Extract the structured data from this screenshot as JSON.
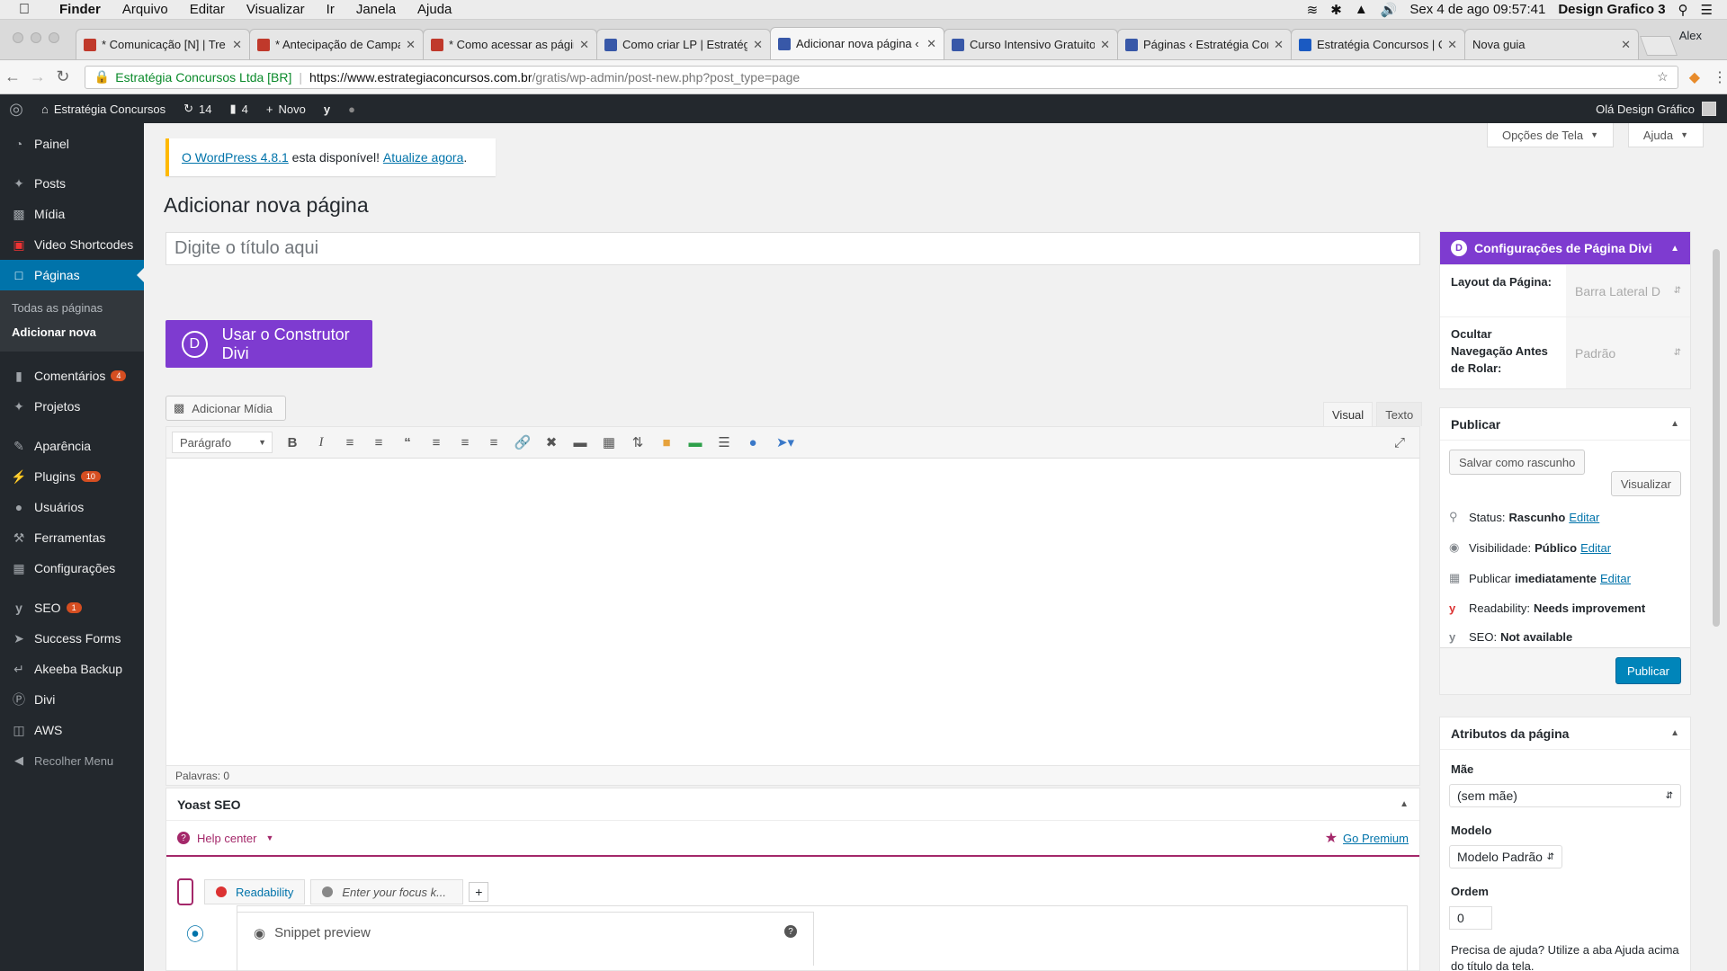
{
  "macos": {
    "finder": "Finder",
    "menus": [
      "Arquivo",
      "Editar",
      "Visualizar",
      "Ir",
      "Janela",
      "Ajuda"
    ],
    "clock": "Sex 4 de ago  09:57:41",
    "user": "Design Grafico 3"
  },
  "browser": {
    "tabs": [
      {
        "title": "* Comunicação [N] | Tre",
        "color": "#c0392b"
      },
      {
        "title": "* Antecipação de Campa",
        "color": "#c0392b"
      },
      {
        "title": "* Como acessar as págin",
        "color": "#c0392b"
      },
      {
        "title": "Como criar LP | Estratég",
        "color": "#3858a8"
      },
      {
        "title": "Adicionar nova página ‹",
        "color": "#3858a8"
      },
      {
        "title": "Curso Intensivo Gratuito",
        "color": "#3858a8"
      },
      {
        "title": "Páginas ‹ Estratégia Con",
        "color": "#3858a8"
      },
      {
        "title": "Estratégia Concursos | C",
        "color": "#1a5ac2"
      },
      {
        "title": "Nova guia",
        "color": ""
      }
    ],
    "profile": "Alex",
    "secure_label": "Estratégia Concursos Ltda [BR]",
    "url_host": "https://www.estrategiaconcursos.com.br",
    "url_path": "/gratis/wp-admin/post-new.php?post_type=page"
  },
  "adminbar": {
    "site": "Estratégia Concursos",
    "updates": "14",
    "comments": "4",
    "new": "Novo",
    "greeting": "Olá Design Gráfico"
  },
  "sidebar": {
    "items": [
      {
        "label": "Painel",
        "icon": "gauge-icon"
      },
      {
        "label": "Posts",
        "icon": "pin-icon"
      },
      {
        "label": "Mídia",
        "icon": "media-icon"
      },
      {
        "label": "Video Shortcodes",
        "icon": "video-icon"
      },
      {
        "label": "Páginas",
        "icon": "page-icon"
      },
      {
        "label": "Comentários",
        "icon": "comment-icon",
        "badge": "4"
      },
      {
        "label": "Projetos",
        "icon": "pin-icon"
      },
      {
        "label": "Aparência",
        "icon": "brush-icon"
      },
      {
        "label": "Plugins",
        "icon": "plug-icon",
        "badge": "10"
      },
      {
        "label": "Usuários",
        "icon": "user-icon"
      },
      {
        "label": "Ferramentas",
        "icon": "wrench-icon"
      },
      {
        "label": "Configurações",
        "icon": "settings-icon"
      },
      {
        "label": "SEO",
        "icon": "yoast-icon",
        "badge": "1"
      },
      {
        "label": "Success Forms",
        "icon": "rocket-icon"
      },
      {
        "label": "Akeeba Backup",
        "icon": "backup-icon"
      },
      {
        "label": "Divi",
        "icon": "divi-icon"
      },
      {
        "label": "AWS",
        "icon": "aws-icon"
      }
    ],
    "sub": [
      "Todas as páginas",
      "Adicionar nova"
    ],
    "collapse": "Recolher Menu"
  },
  "main": {
    "screen_options": "Opções de Tela",
    "help": "Ajuda",
    "notice_link1": "O WordPress 4.8.1",
    "notice_text": " esta disponível! ",
    "notice_link2": "Atualize agora",
    "notice_end": ".",
    "page_title": "Adicionar nova página",
    "title_placeholder": "Digite o título aqui",
    "divi_button": "Usar o Construtor Divi",
    "add_media": "Adicionar Mídia",
    "tab_visual": "Visual",
    "tab_text": "Texto",
    "format": "Parágrafo",
    "word_count": "Palavras: 0"
  },
  "yoast": {
    "title": "Yoast SEO",
    "help_center": "Help center",
    "go_premium": "Go Premium",
    "readability_tab": "Readability",
    "focus_tab": "Enter your focus k...",
    "snippet": "Snippet preview"
  },
  "divi_settings": {
    "title": "Configurações de Página Divi",
    "layout_label": "Layout da Página:",
    "layout_value": "Barra Lateral D",
    "hide_nav_label": "Ocultar Navegação Antes de Rolar:",
    "hide_nav_value": "Padrão"
  },
  "publish": {
    "title": "Publicar",
    "save_draft": "Salvar como rascunho",
    "preview": "Visualizar",
    "status_label": "Status:",
    "status_value": "Rascunho",
    "visibility_label": "Visibilidade:",
    "visibility_value": "Público",
    "publish_label": "Publicar",
    "publish_value": "imediatamente",
    "edit": "Editar",
    "readability_label": "Readability:",
    "readability_value": "Needs improvement",
    "seo_label": "SEO:",
    "seo_value": "Not available",
    "publish_button": "Publicar"
  },
  "attributes": {
    "title": "Atributos da página",
    "parent_label": "Mãe",
    "parent_value": "(sem mãe)",
    "template_label": "Modelo",
    "template_value": "Modelo Padrão",
    "order_label": "Ordem",
    "order_value": "0",
    "help_text": "Precisa de ajuda? Utilize a aba Ajuda acima do título da tela."
  },
  "colors": {
    "divi_purple": "#7e3bd0",
    "wp_blue": "#0073aa",
    "admin_dark": "#23282d",
    "yoast_magenta": "#a4286a"
  }
}
